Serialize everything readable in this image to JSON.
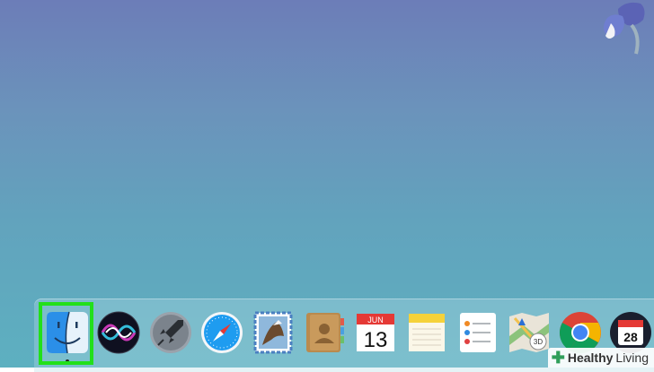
{
  "dock": {
    "items": [
      {
        "name": "Finder",
        "icon": "finder-icon"
      },
      {
        "name": "Siri",
        "icon": "siri-icon"
      },
      {
        "name": "Launchpad",
        "icon": "launchpad-icon"
      },
      {
        "name": "Safari",
        "icon": "safari-icon"
      },
      {
        "name": "Mail",
        "icon": "mail-icon"
      },
      {
        "name": "Contacts",
        "icon": "contacts-icon"
      },
      {
        "name": "Calendar",
        "icon": "calendar-icon",
        "month": "JUN",
        "day": "13"
      },
      {
        "name": "Notes",
        "icon": "notes-icon"
      },
      {
        "name": "Reminders",
        "icon": "reminders-icon"
      },
      {
        "name": "Maps",
        "icon": "maps-icon",
        "badge": "3D"
      },
      {
        "name": "Chrome",
        "icon": "chrome-icon"
      },
      {
        "name": "Fantastical",
        "icon": "fantastical-calendar-icon",
        "day": "28"
      }
    ],
    "highlight_color": "#22e01a"
  },
  "watermark": {
    "part1": "Healthy",
    "part2": "Living"
  }
}
